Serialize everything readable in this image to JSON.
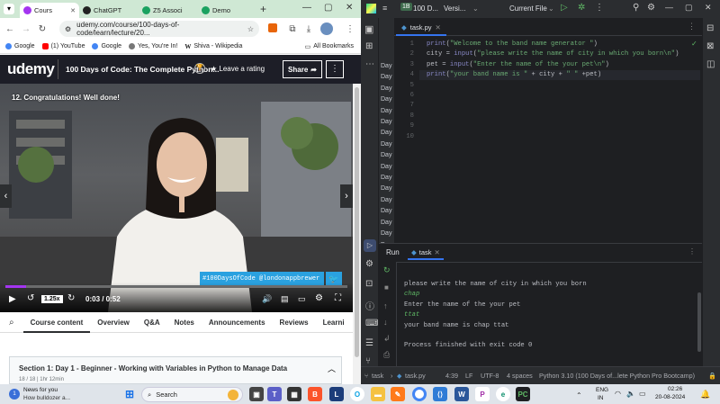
{
  "browser": {
    "tabs": [
      {
        "title": "Cours",
        "active": true,
        "color": "#a435f0"
      },
      {
        "title": "ChatGPT",
        "active": false,
        "color": "#222"
      },
      {
        "title": "Z5 Associ",
        "active": false,
        "color": "#1aa260"
      },
      {
        "title": "Demo",
        "active": false,
        "color": "#1aa260"
      }
    ],
    "url": "udemy.com/course/100-days-of-code/learn/lecture/20...",
    "bookmarks": [
      "Google",
      "(1) YouTube",
      "Google",
      "Yes, You're In!",
      "Shiva - Wikipedia"
    ],
    "all_bookmarks": "All Bookmarks"
  },
  "udemy": {
    "logo": "udemy",
    "course_title": "100 Days of Code: The Complete Python...",
    "rating_label": "Leave a rating",
    "share_label": "Share",
    "lecture_title": "12. Congratulations! Well done!",
    "hashtag": "#100DaysOfCode @londonappbrewer",
    "speed": "1.25x",
    "time": "0:03 / 0:52",
    "progress": 0.06,
    "tabs": [
      "Course content",
      "Overview",
      "Q&A",
      "Notes",
      "Announcements",
      "Reviews",
      "Learni"
    ],
    "section_title": "Section 1: Day 1 - Beginner - Working with Variables in Python to Manage Data",
    "section_meta": "18 / 18 | 1hr 12min"
  },
  "ide": {
    "project_badge": "1B",
    "project": "100 D...",
    "vcs": "Versi...",
    "run_config": "Current File",
    "file_tab": "task.py",
    "project_items": [
      "Day",
      "Day",
      "Day",
      "Day",
      "Day",
      "Day",
      "Day",
      "Day",
      "Day",
      "Day",
      "Day",
      "Day",
      "Day",
      "Day",
      "Day",
      "Day",
      "Day",
      "Day"
    ],
    "code_lines": [
      "print(\"Welcome to the band name generator \")",
      "city = input(\"please write the name of city in which you born\\n\")",
      "pet = input(\"Enter the name of the your pet\\n\")",
      "print(\"your band name is \" + city + \" \" +pet)"
    ],
    "line_numbers": [
      "1",
      "2",
      "3",
      "4",
      "5",
      "6",
      "7",
      "8",
      "9",
      "10"
    ],
    "run_label": "Run",
    "run_tab": "task",
    "console": [
      {
        "text": "please write the name of city in which you born",
        "input": false
      },
      {
        "text": "chap",
        "input": true
      },
      {
        "text": "Enter the name of the your pet",
        "input": false
      },
      {
        "text": "ttat",
        "input": true
      },
      {
        "text": "your band name is chap ttat",
        "input": false
      },
      {
        "text": "",
        "input": false
      },
      {
        "text": "Process finished with exit code 0",
        "input": false
      }
    ],
    "status": {
      "breadcrumb_1": "task",
      "breadcrumb_2": "task.py",
      "position": "4:39",
      "line_sep": "LF",
      "encoding": "UTF-8",
      "indent": "4 spaces",
      "interpreter": "Python 3.10 (100 Days of...lete Python Pro Bootcamp)"
    }
  },
  "taskbar": {
    "news_title": "News for you",
    "news_sub": "How bulldozer a...",
    "search": "Search",
    "lang_1": "ENG",
    "lang_2": "IN",
    "time": "02:26",
    "date": "20-08-2024"
  }
}
